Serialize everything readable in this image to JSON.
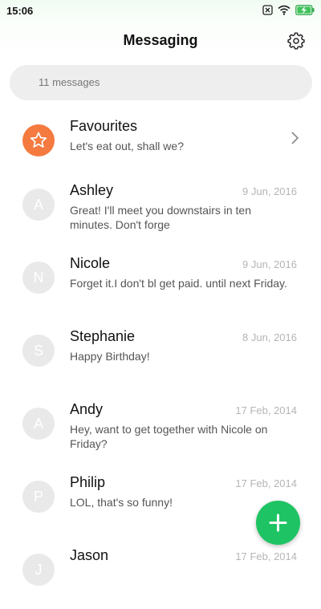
{
  "status": {
    "time": "15:06"
  },
  "header": {
    "title": "Messaging"
  },
  "search": {
    "placeholder": "11 messages"
  },
  "favourites": {
    "name": "Favourites",
    "preview": "Let's eat out, shall we?"
  },
  "conversations": [
    {
      "initial": "A",
      "name": "Ashley",
      "date": "9 Jun, 2016",
      "preview": "Great! I'll meet you downstairs in ten minutes. Don't forge"
    },
    {
      "initial": "N",
      "name": "Nicole",
      "date": "9 Jun, 2016",
      "preview": "Forget it.I don't bl get paid. until next Friday."
    },
    {
      "initial": "S",
      "name": "Stephanie",
      "date": "8 Jun, 2016",
      "preview": "Happy Birthday!"
    },
    {
      "initial": "A",
      "name": "Andy",
      "date": "17 Feb, 2014",
      "preview": "Hey, want to get together with Nicole on Friday?"
    },
    {
      "initial": "P",
      "name": "Philip",
      "date": "17 Feb, 2014",
      "preview": "LOL, that's so funny!"
    },
    {
      "initial": "J",
      "name": "Jason",
      "date": "17 Feb, 2014",
      "preview": ""
    }
  ],
  "colors": {
    "accent": "#1ec463",
    "favourite": "#f47a3f",
    "avatar": "#e9e9e9"
  },
  "icons": {
    "settings": "gear-icon",
    "favourite": "star-icon",
    "chevron": "chevron-right-icon",
    "compose": "plus-icon"
  }
}
